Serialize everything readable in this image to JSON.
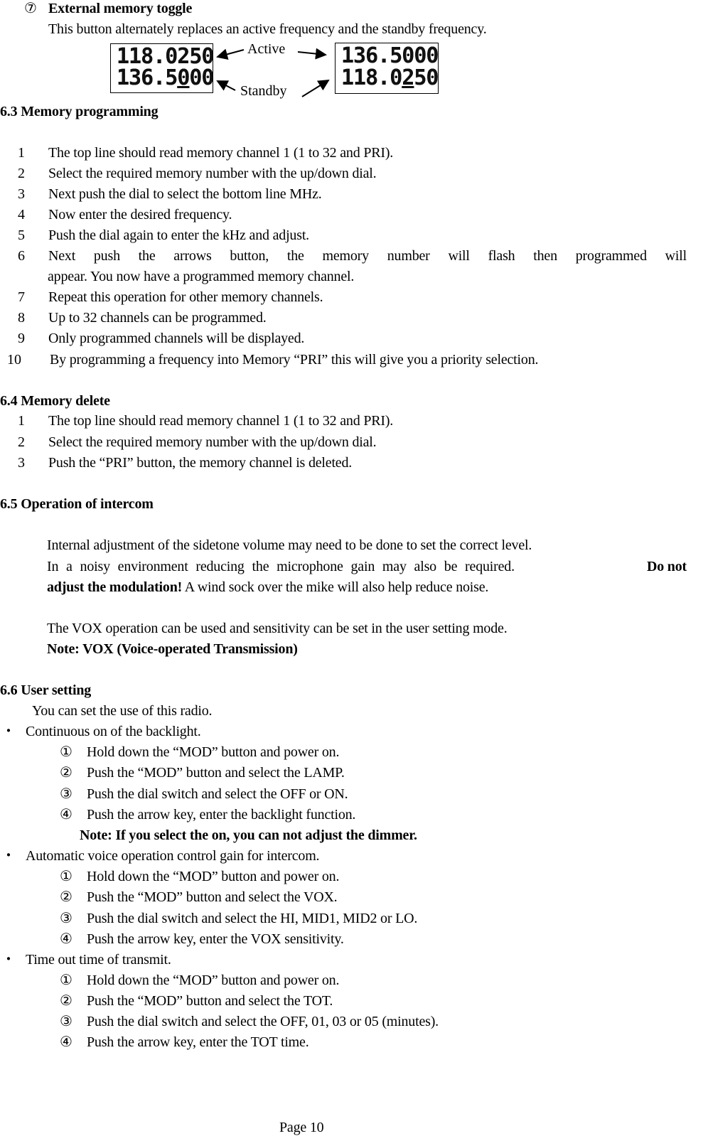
{
  "section_external": {
    "marker": "⑦",
    "title": "External memory toggle",
    "description": "This button alternately replaces an active frequency and the standby frequency.",
    "diagram": {
      "before": {
        "active": "118.0250",
        "standby_prefix": "136.5",
        "standby_cursor": "0",
        "standby_suffix": "00"
      },
      "after": {
        "active": "136.5000",
        "standby_prefix": "118.0",
        "standby_cursor": "2",
        "standby_suffix": "50"
      },
      "active_label": "Active",
      "standby_label": "Standby"
    }
  },
  "section_63": {
    "heading": "6.3 Memory programming",
    "steps": [
      {
        "n": "1",
        "text": "The top line should read memory channel 1 (1 to 32 and PRI)."
      },
      {
        "n": "2",
        "text": "Select the required memory number with the up/down dial."
      },
      {
        "n": "3",
        "text": "Next push the dial to select the bottom line MHz."
      },
      {
        "n": "4",
        "text": "Now enter the desired frequency."
      },
      {
        "n": "5",
        "text": "Push the dial again to enter the kHz and adjust."
      },
      {
        "n": "6",
        "text": "Next push the arrows button, the memory number will flash then programmed will",
        "text2": "appear. You now have a programmed memory channel."
      },
      {
        "n": "7",
        "text": "Repeat this operation for other memory channels."
      },
      {
        "n": "8",
        "text": "Up to 32 channels can be programmed."
      },
      {
        "n": "9",
        "text": "Only programmed channels will be displayed."
      },
      {
        "n": "10",
        "text": "By programming a frequency into Memory “PRI” this will give you a priority selection."
      }
    ]
  },
  "section_64": {
    "heading": "6.4 Memory delete",
    "steps": [
      {
        "n": "1",
        "text": "The top line should read memory channel 1 (1 to 32 and PRI)."
      },
      {
        "n": "2",
        "text": "Select the required memory number with the up/down dial."
      },
      {
        "n": "3",
        "text": "Push the “PRI” button, the memory channel is deleted."
      }
    ]
  },
  "section_65": {
    "heading": "6.5 Operation of intercom",
    "para1_line1": "Internal adjustment of the sidetone volume may need to be done to set the correct level.",
    "para1_line2": "In a noisy environment reducing the microphone gain may also be required.",
    "para1_bold1": "Do not",
    "para1_bold2": "adjust the modulation!",
    "para1_line3": " A wind sock over the mike will also help reduce noise.",
    "para2": "The VOX operation can be used and sensitivity can be set in the user setting mode.",
    "note": "Note: VOX (Voice-operated Transmission)"
  },
  "section_66": {
    "heading": "6.6 User setting",
    "intro": "You can set the use of this radio.",
    "bullet_glyph": "・",
    "groups": [
      {
        "title": "Continuous on of the backlight.",
        "steps": [
          {
            "n": "①",
            "text": "Hold down the “MOD” button and power on."
          },
          {
            "n": "②",
            "text": "Push the “MOD” button and select the LAMP."
          },
          {
            "n": "③",
            "text": "Push the dial switch and select the OFF or ON."
          },
          {
            "n": "④",
            "text": "Push the arrow key, enter the backlight function."
          }
        ],
        "note": "Note: If you select the on, you can not adjust the dimmer."
      },
      {
        "title": "Automatic voice operation control gain for intercom.",
        "steps": [
          {
            "n": "①",
            "text": "Hold down the “MOD” button and power on."
          },
          {
            "n": "②",
            "text": "Push the “MOD” button and select the VOX."
          },
          {
            "n": "③",
            "text": "Push the dial switch and select the HI, MID1, MID2 or LO."
          },
          {
            "n": "④",
            "text": "Push the arrow key, enter the VOX sensitivity."
          }
        ]
      },
      {
        "title": "Time out time of transmit.",
        "steps": [
          {
            "n": "①",
            "text": "Hold down the “MOD” button and power on."
          },
          {
            "n": "②",
            "text": "Push the “MOD” button and select the TOT."
          },
          {
            "n": "③",
            "text": "Push the dial switch and select the OFF, 01, 03 or 05 (minutes)."
          },
          {
            "n": "④",
            "text": "Push the arrow key, enter the TOT time."
          }
        ]
      }
    ]
  },
  "footer": {
    "page_label": "Page 10"
  }
}
